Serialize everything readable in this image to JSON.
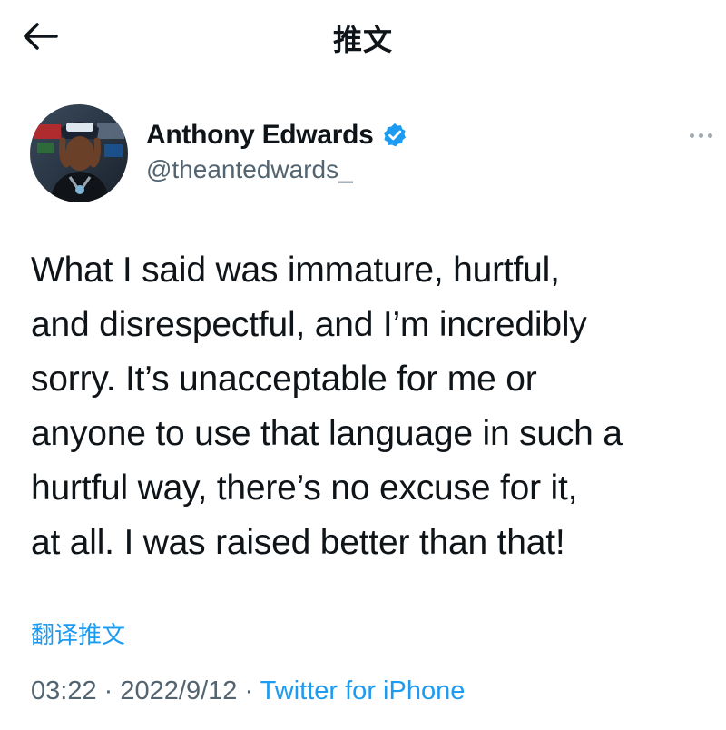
{
  "header": {
    "title": "推文",
    "back_icon": "arrow-left-icon"
  },
  "author": {
    "display_name": "Anthony Edwards",
    "handle": "@theantedwards_",
    "verified_icon": "verified-badge-icon",
    "verified_color": "#1d9bf0"
  },
  "tweet": {
    "text": "What I said was immature, hurtful,\nand disrespectful, and I’m incredibly\nsorry. It’s unacceptable for me or\nanyone to use that language in such a\nhurtful way, there’s no excuse for it,\nat all. I was raised better than that!",
    "translate_label": "翻译推文"
  },
  "meta": {
    "time": "03:22",
    "separator": "·",
    "date": "2022/9/12",
    "source": "Twitter for iPhone"
  },
  "colors": {
    "accent": "#1d9bf0",
    "secondary_text": "#536471",
    "primary_text": "#0f1419"
  }
}
